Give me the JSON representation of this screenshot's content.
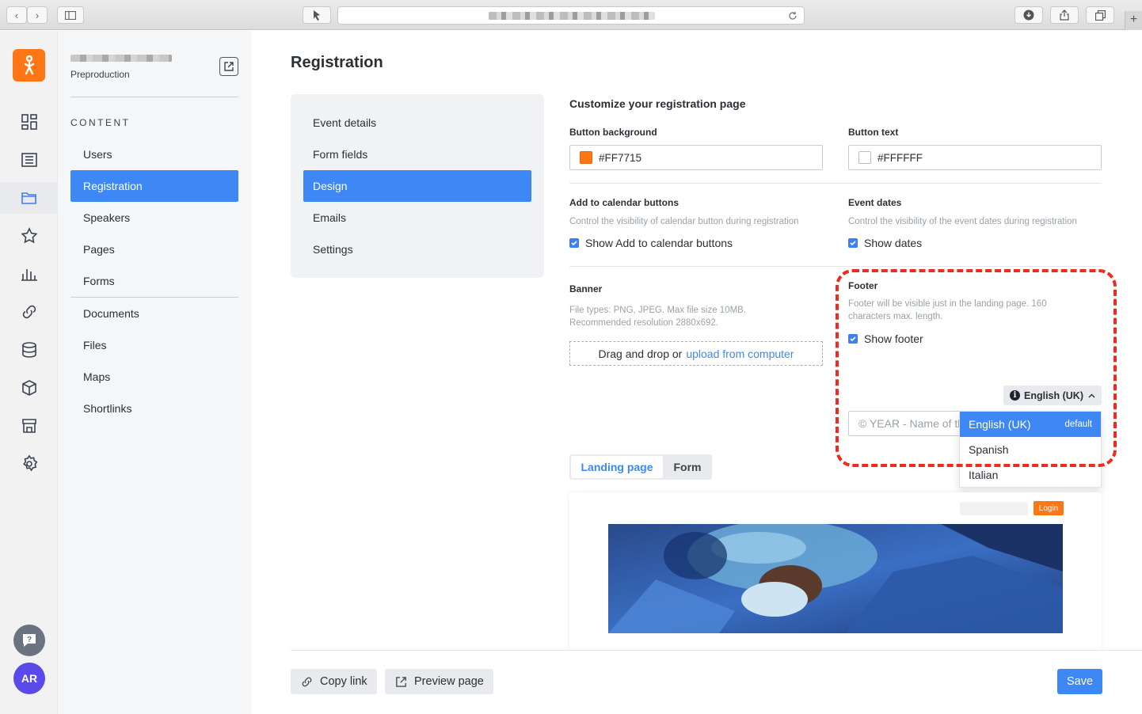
{
  "browser": {
    "plus": "+"
  },
  "org": {
    "subtitle": "Preproduction"
  },
  "nav": {
    "section": "CONTENT",
    "items": [
      {
        "label": "Users"
      },
      {
        "label": "Registration"
      },
      {
        "label": "Speakers"
      },
      {
        "label": "Pages"
      },
      {
        "label": "Forms"
      },
      {
        "label": "Documents"
      },
      {
        "label": "Files"
      },
      {
        "label": "Maps"
      },
      {
        "label": "Shortlinks"
      }
    ]
  },
  "user": {
    "initials": "AR"
  },
  "page": {
    "title": "Registration"
  },
  "subnav": {
    "items": [
      "Event details",
      "Form fields",
      "Design",
      "Emails",
      "Settings"
    ]
  },
  "design": {
    "heading": "Customize your registration page",
    "button_background": {
      "label": "Button background",
      "value": "#FF7715",
      "color": "#FF7715"
    },
    "button_text": {
      "label": "Button text",
      "value": "#FFFFFF",
      "color": "#FFFFFF"
    },
    "calendar": {
      "label": "Add to calendar buttons",
      "help": "Control the visibility of calendar button during registration",
      "checkbox": "Show Add to calendar buttons"
    },
    "event_dates": {
      "label": "Event dates",
      "help": "Control the visibility of the event dates during registration",
      "checkbox": "Show dates"
    },
    "banner": {
      "label": "Banner",
      "help1": "File types: PNG, JPEG. Max file size 10MB.",
      "help2": "Recommended resolution 2880x692.",
      "drop_text": "Drag and drop or",
      "upload_link": "upload from computer"
    },
    "footer": {
      "label": "Footer",
      "help1": "Footer will be visible just in the landing page. 160",
      "help2": "characters max. length.",
      "checkbox": "Show footer",
      "language": "English (UK)",
      "placeholder": "© YEAR - Name of the event",
      "options": [
        {
          "label": "English (UK)",
          "tag": "default"
        },
        {
          "label": "Spanish",
          "tag": ""
        },
        {
          "label": "Italian",
          "tag": ""
        }
      ]
    }
  },
  "preview": {
    "tabs": [
      "Landing page",
      "Form"
    ],
    "login": "Login"
  },
  "actions": {
    "copy_link": "Copy link",
    "preview_page": "Preview page",
    "save": "Save"
  },
  "colors": {
    "accent": "#3E88F6",
    "brand": "#FF7715",
    "highlight": "#EE2B1F"
  }
}
